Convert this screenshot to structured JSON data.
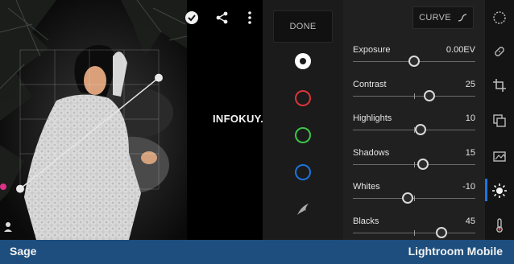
{
  "photo": {
    "top_icons": [
      "check-circle-icon",
      "share-icon",
      "more-vert-icon"
    ],
    "curve_points": [
      {
        "x": 0,
        "y": 0.17
      },
      {
        "x": 1,
        "y": 0.8
      }
    ]
  },
  "color_channels": {
    "done_label": "DONE",
    "items": [
      {
        "name": "white-channel",
        "color": "#ffffff"
      },
      {
        "name": "red-channel",
        "color": "#d9353b"
      },
      {
        "name": "green-channel",
        "color": "#3cc44a"
      },
      {
        "name": "blue-channel",
        "color": "#1d73d9"
      },
      {
        "name": "swirl-icon",
        "color": "#bbbbbb"
      }
    ]
  },
  "panel": {
    "curve_label": "CURVE",
    "sliders": [
      {
        "label": "Exposure",
        "value": "0.00EV",
        "position": 0.5
      },
      {
        "label": "Contrast",
        "value": "25",
        "position": 0.625
      },
      {
        "label": "Highlights",
        "value": "10",
        "position": 0.55
      },
      {
        "label": "Shadows",
        "value": "15",
        "position": 0.575
      },
      {
        "label": "Whites",
        "value": "-10",
        "position": 0.45
      },
      {
        "label": "Blacks",
        "value": "45",
        "position": 0.725
      }
    ]
  },
  "toolbar": {
    "tools": [
      "selective-icon",
      "crop-icon",
      "presets-icon",
      "healing-icon",
      "profile-icon",
      "light-icon",
      "color-icon"
    ],
    "active": "light-icon",
    "accent": "#1b74e4"
  },
  "watermark": "INFOKUY.NET",
  "footer": {
    "left": "Sage",
    "right": "Lightroom Mobile",
    "background": "#1d4e7e"
  }
}
